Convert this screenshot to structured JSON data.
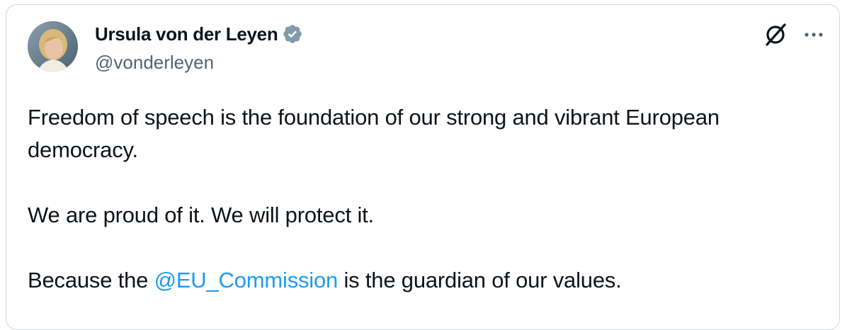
{
  "author": {
    "display_name": "Ursula von der Leyen",
    "handle": "@vonderleyen",
    "verified_badge_icon": "verified-badge-icon",
    "badge_color": "#829aab"
  },
  "actions": {
    "grok_icon": "grok-icon",
    "more_icon": "more-options-icon"
  },
  "tweet": {
    "line1": "Freedom of speech is the foundation of our strong and vibrant European democracy.",
    "line2": "We are proud of it. We will protect it.",
    "line3_prefix": "Because the ",
    "mention": "@EU_Commission",
    "line3_suffix": " is the guardian of our values."
  },
  "colors": {
    "text": "#0f1419",
    "secondary": "#536471",
    "link": "#1d9bf0",
    "border": "#cfd9de"
  }
}
